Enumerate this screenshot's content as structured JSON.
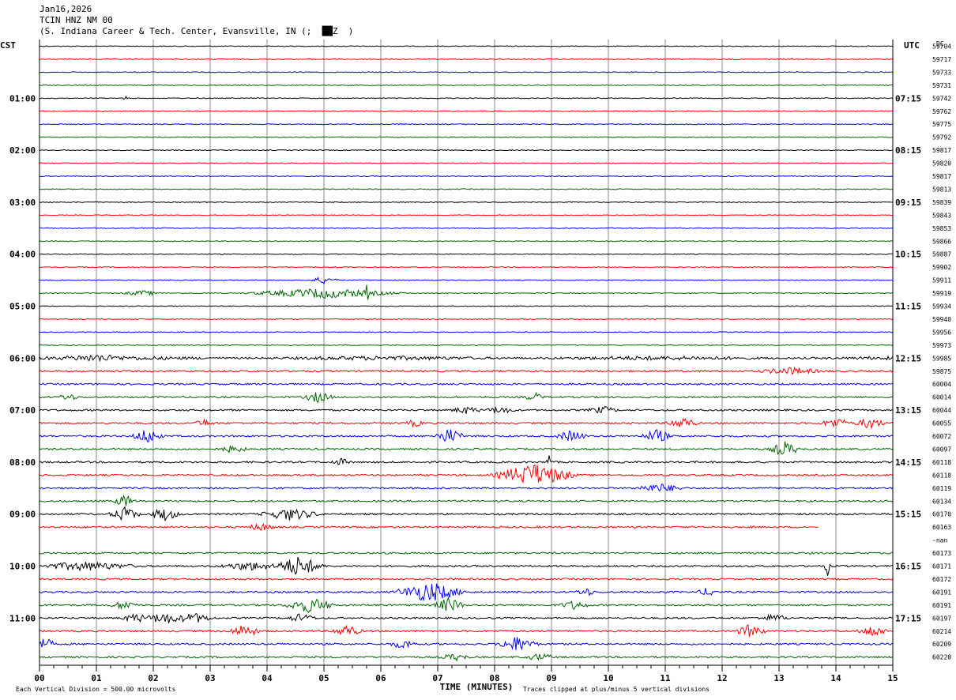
{
  "header": {
    "date": "Jan16,2026",
    "station": "TCIN HNZ NM 00",
    "location": "(S. Indiana Career & Tech. Center, Evansville, IN (;  ██Z  )"
  },
  "chart_data": {
    "type": "line",
    "left_timezone": "CST",
    "right_timezone": "UTC",
    "dc_header": "DC",
    "xlabel": "TIME (MINUTES)",
    "x_ticks": [
      "00",
      "01",
      "02",
      "03",
      "04",
      "05",
      "06",
      "07",
      "08",
      "09",
      "10",
      "11",
      "12",
      "13",
      "14",
      "15"
    ],
    "xlim": [
      0,
      15
    ],
    "left_hour_labels": [
      {
        "row": 4,
        "label": "01:00"
      },
      {
        "row": 8,
        "label": "02:00"
      },
      {
        "row": 12,
        "label": "03:00"
      },
      {
        "row": 16,
        "label": "04:00"
      },
      {
        "row": 20,
        "label": "05:00"
      },
      {
        "row": 24,
        "label": "06:00"
      },
      {
        "row": 28,
        "label": "07:00"
      },
      {
        "row": 32,
        "label": "08:00"
      },
      {
        "row": 36,
        "label": "09:00"
      },
      {
        "row": 40,
        "label": "10:00"
      },
      {
        "row": 44,
        "label": "11:00"
      }
    ],
    "right_hour_labels": [
      {
        "row": 4,
        "label": "07:15"
      },
      {
        "row": 8,
        "label": "08:15"
      },
      {
        "row": 12,
        "label": "09:15"
      },
      {
        "row": 16,
        "label": "10:15"
      },
      {
        "row": 20,
        "label": "11:15"
      },
      {
        "row": 24,
        "label": "12:15"
      },
      {
        "row": 28,
        "label": "13:15"
      },
      {
        "row": 32,
        "label": "14:15"
      },
      {
        "row": 36,
        "label": "15:15"
      },
      {
        "row": 40,
        "label": "16:15"
      },
      {
        "row": 44,
        "label": "17:15"
      }
    ],
    "dc_values": [
      "59704",
      "59717",
      "59733",
      "59731",
      "59742",
      "59762",
      "59775",
      "59792",
      "59817",
      "59820",
      "59817",
      "59813",
      "59839",
      "59843",
      "59853",
      "59866",
      "59887",
      "59902",
      "59911",
      "59919",
      "59934",
      "59940",
      "59956",
      "59973",
      "59985",
      "59875",
      "60004",
      "60014",
      "60044",
      "60055",
      "60072",
      "60097",
      "60118",
      "60118",
      "60119",
      "60134",
      "60170",
      "60163",
      "-nan",
      "60173",
      "60171",
      "60172",
      "60191",
      "60191",
      "60197",
      "60214",
      "60209",
      "60220"
    ],
    "trace_colors": [
      "#000000",
      "#ff0000",
      "#0000ff",
      "#006400"
    ],
    "events": [
      {
        "row": 4,
        "minute": 1.5,
        "amp": 3,
        "dur": 0.05
      },
      {
        "row": 18,
        "minute": 5.0,
        "amp": 4,
        "dur": 0.3
      },
      {
        "row": 19,
        "minute": 1.8,
        "amp": 3,
        "dur": 0.4
      },
      {
        "row": 19,
        "minute": 5.0,
        "amp": 6,
        "dur": 1.5
      },
      {
        "row": 19,
        "minute": 5.75,
        "amp": 14,
        "dur": 0.05
      },
      {
        "row": 24,
        "minute": 1.0,
        "amp": 4,
        "dur": 0.8
      },
      {
        "row": 25,
        "minute": 13.2,
        "amp": 4,
        "dur": 0.6
      },
      {
        "row": 27,
        "minute": 0.5,
        "amp": 4,
        "dur": 0.2
      },
      {
        "row": 27,
        "minute": 4.9,
        "amp": 6,
        "dur": 0.3
      },
      {
        "row": 27,
        "minute": 8.7,
        "amp": 5,
        "dur": 0.2
      },
      {
        "row": 28,
        "minute": 7.5,
        "amp": 4,
        "dur": 0.3
      },
      {
        "row": 28,
        "minute": 8.1,
        "amp": 4,
        "dur": 0.3
      },
      {
        "row": 28,
        "minute": 9.9,
        "amp": 4,
        "dur": 0.3
      },
      {
        "row": 29,
        "minute": 2.9,
        "amp": 4,
        "dur": 0.2
      },
      {
        "row": 29,
        "minute": 6.6,
        "amp": 4,
        "dur": 0.2
      },
      {
        "row": 29,
        "minute": 11.3,
        "amp": 7,
        "dur": 0.3
      },
      {
        "row": 29,
        "minute": 14.0,
        "amp": 6,
        "dur": 0.3
      },
      {
        "row": 29,
        "minute": 14.6,
        "amp": 7,
        "dur": 0.3
      },
      {
        "row": 30,
        "minute": 1.9,
        "amp": 9,
        "dur": 0.3
      },
      {
        "row": 30,
        "minute": 7.2,
        "amp": 9,
        "dur": 0.3
      },
      {
        "row": 30,
        "minute": 9.35,
        "amp": 7,
        "dur": 0.3
      },
      {
        "row": 30,
        "minute": 10.85,
        "amp": 8,
        "dur": 0.3
      },
      {
        "row": 31,
        "minute": 3.4,
        "amp": 4,
        "dur": 0.3
      },
      {
        "row": 31,
        "minute": 13.1,
        "amp": 9,
        "dur": 0.3
      },
      {
        "row": 32,
        "minute": 5.3,
        "amp": 4,
        "dur": 0.2
      },
      {
        "row": 32,
        "minute": 8.95,
        "amp": 14,
        "dur": 0.05
      },
      {
        "row": 33,
        "minute": 8.7,
        "amp": 14,
        "dur": 0.8
      },
      {
        "row": 34,
        "minute": 10.9,
        "amp": 5,
        "dur": 0.5
      },
      {
        "row": 35,
        "minute": 1.5,
        "amp": 8,
        "dur": 0.2
      },
      {
        "row": 36,
        "minute": 1.5,
        "amp": 9,
        "dur": 0.3
      },
      {
        "row": 36,
        "minute": 2.2,
        "amp": 8,
        "dur": 0.3
      },
      {
        "row": 36,
        "minute": 4.4,
        "amp": 7,
        "dur": 0.6
      },
      {
        "row": 37,
        "minute": 3.9,
        "amp": 4,
        "dur": 0.3
      },
      {
        "row": 40,
        "minute": 0.8,
        "amp": 5,
        "dur": 1.0
      },
      {
        "row": 40,
        "minute": 3.7,
        "amp": 5,
        "dur": 0.6
      },
      {
        "row": 40,
        "minute": 4.55,
        "amp": 12,
        "dur": 0.5
      },
      {
        "row": 40,
        "minute": 13.85,
        "amp": 14,
        "dur": 0.05
      },
      {
        "row": 42,
        "minute": 6.85,
        "amp": 12,
        "dur": 0.7
      },
      {
        "row": 42,
        "minute": 9.6,
        "amp": 5,
        "dur": 0.2
      },
      {
        "row": 42,
        "minute": 11.75,
        "amp": 5,
        "dur": 0.2
      },
      {
        "row": 43,
        "minute": 1.5,
        "amp": 5,
        "dur": 0.3
      },
      {
        "row": 43,
        "minute": 4.75,
        "amp": 9,
        "dur": 0.5
      },
      {
        "row": 43,
        "minute": 7.2,
        "amp": 9,
        "dur": 0.3
      },
      {
        "row": 43,
        "minute": 9.4,
        "amp": 5,
        "dur": 0.3
      },
      {
        "row": 44,
        "minute": 1.7,
        "amp": 5,
        "dur": 0.3
      },
      {
        "row": 44,
        "minute": 2.2,
        "amp": 7,
        "dur": 0.4
      },
      {
        "row": 44,
        "minute": 2.7,
        "amp": 6,
        "dur": 0.4
      },
      {
        "row": 44,
        "minute": 4.6,
        "amp": 5,
        "dur": 0.3
      },
      {
        "row": 44,
        "minute": 12.9,
        "amp": 4,
        "dur": 0.3
      },
      {
        "row": 45,
        "minute": 3.6,
        "amp": 8,
        "dur": 0.3
      },
      {
        "row": 45,
        "minute": 5.4,
        "amp": 7,
        "dur": 0.3
      },
      {
        "row": 45,
        "minute": 12.5,
        "amp": 8,
        "dur": 0.3
      },
      {
        "row": 45,
        "minute": 14.65,
        "amp": 7,
        "dur": 0.3
      },
      {
        "row": 46,
        "minute": 0.1,
        "amp": 7,
        "dur": 0.2
      },
      {
        "row": 46,
        "minute": 6.4,
        "amp": 5,
        "dur": 0.3
      },
      {
        "row": 46,
        "minute": 8.4,
        "amp": 9,
        "dur": 0.4
      },
      {
        "row": 47,
        "minute": 7.3,
        "amp": 4,
        "dur": 0.3
      },
      {
        "row": 47,
        "minute": 8.8,
        "amp": 4,
        "dur": 0.3
      }
    ],
    "truncated_trace": {
      "row": 37,
      "end_minute": 13.7
    },
    "missing_trace_row": 38,
    "footer_left": "Each Vertical Division =  500.00 microvolts",
    "footer_right": "Traces clipped at plus/minus 5 vertical divisions"
  }
}
